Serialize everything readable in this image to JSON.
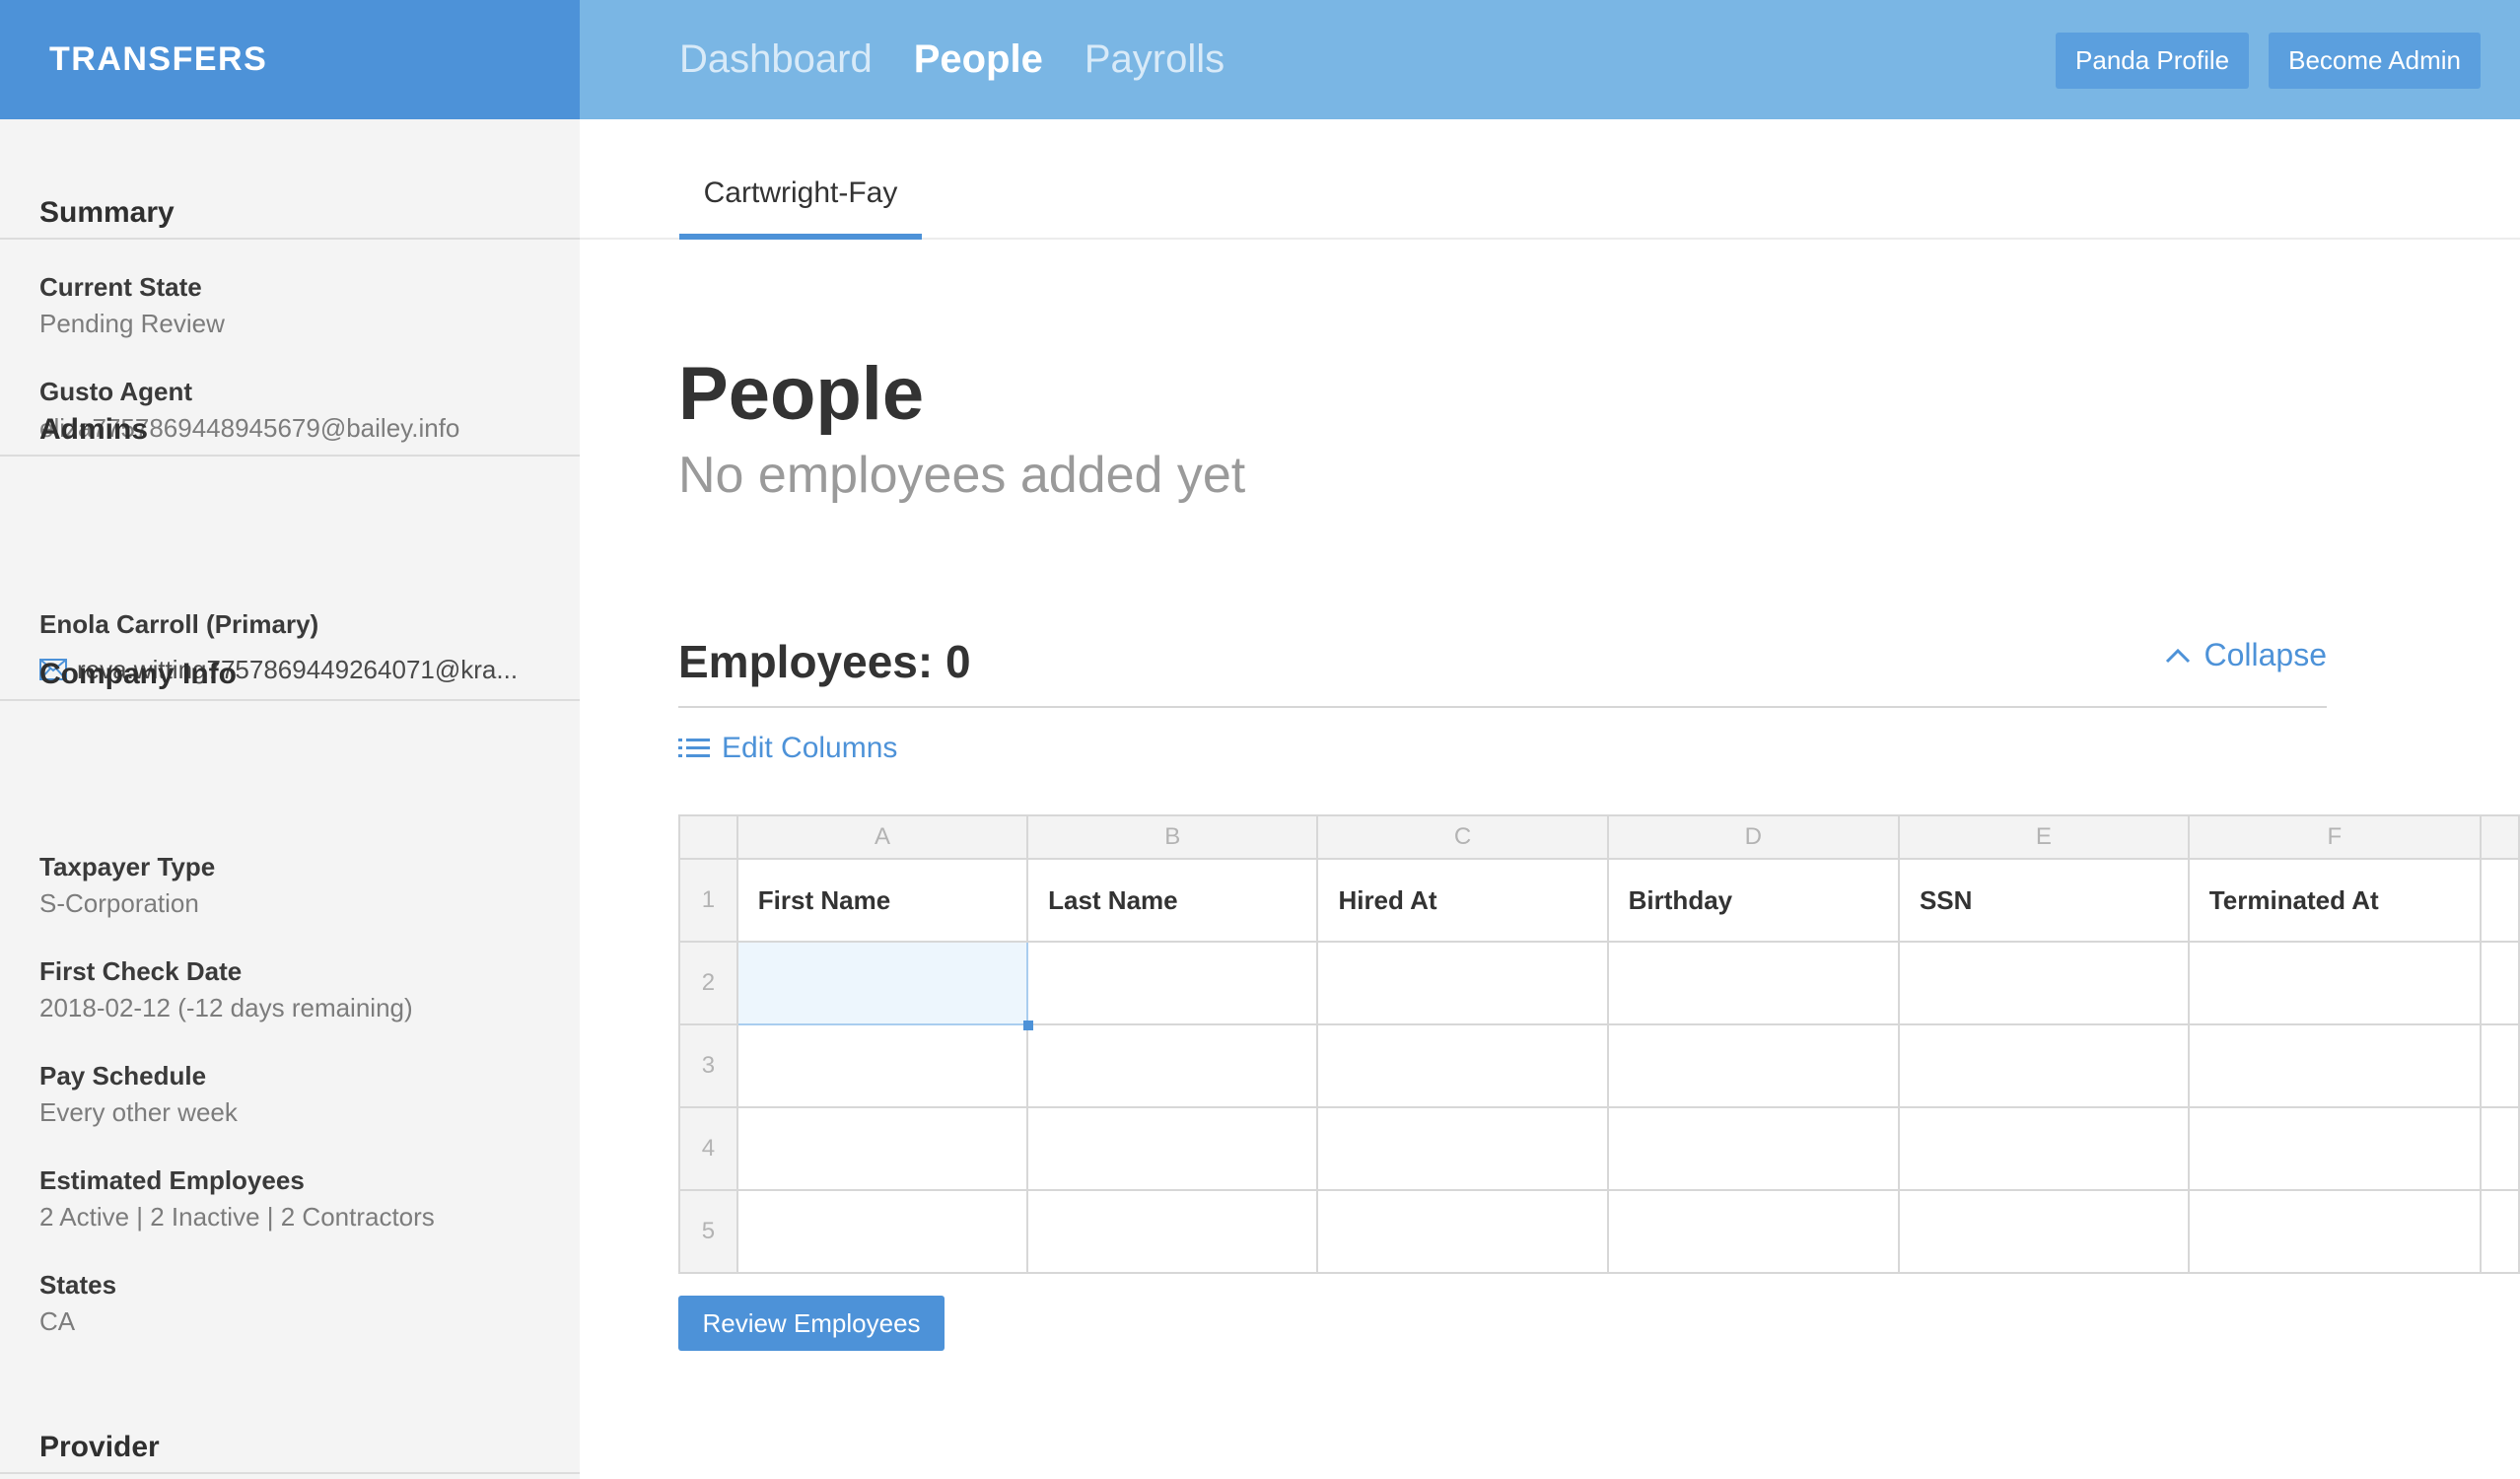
{
  "brand": {
    "title": "TRANSFERS"
  },
  "nav": {
    "links": [
      "Dashboard",
      "People",
      "Payrolls"
    ],
    "active": "People",
    "buttons": [
      "Panda Profile",
      "Become Admin"
    ]
  },
  "sidebar": {
    "summary": {
      "heading": "Summary",
      "current_state": {
        "label": "Current State",
        "value": "Pending Review"
      },
      "gusto_agent": {
        "label": "Gusto Agent",
        "value": "eliza7757869448945679@bailey.info"
      }
    },
    "admins": {
      "heading": "Admins",
      "primary": {
        "name": "Enola Carroll (Primary)",
        "email": "reva.witting7757869449264071@kra..."
      }
    },
    "company_info": {
      "heading": "Company Info",
      "taxpayer_type": {
        "label": "Taxpayer Type",
        "value": "S-Corporation"
      },
      "first_check_date": {
        "label": "First Check Date",
        "value": "2018-02-12 (-12 days remaining)"
      },
      "pay_schedule": {
        "label": "Pay Schedule",
        "value": "Every other week"
      },
      "estimated_employees": {
        "label": "Estimated Employees",
        "value": "2 Active | 2 Inactive | 2 Contractors"
      },
      "states": {
        "label": "States",
        "value": "CA"
      }
    },
    "provider": {
      "heading": "Provider"
    }
  },
  "main": {
    "company_tab": "Cartwright-Fay",
    "title": "People",
    "subtitle": "No employees added yet",
    "employees_heading": "Employees: 0",
    "collapse_label": "Collapse",
    "edit_columns_label": "Edit Columns",
    "grid": {
      "column_letters": [
        "A",
        "B",
        "C",
        "D",
        "E",
        "F"
      ],
      "headers": [
        "First Name",
        "Last Name",
        "Hired At",
        "Birthday",
        "SSN",
        "Terminated At"
      ],
      "row_numbers": [
        "1",
        "2",
        "3",
        "4",
        "5"
      ]
    },
    "review_button": "Review Employees"
  },
  "colors": {
    "brand_blue": "#4d92d8",
    "topnav_blue": "#7ab6e4",
    "sidebar_bg": "#f4f4f4"
  }
}
